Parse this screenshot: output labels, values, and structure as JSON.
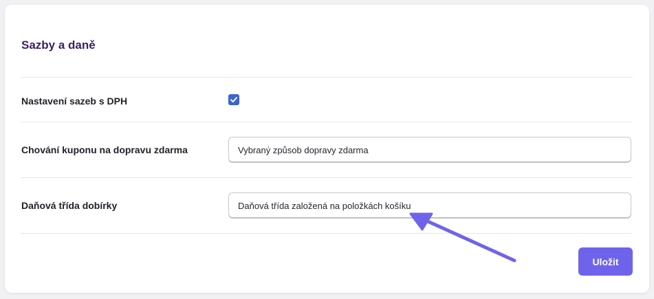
{
  "section": {
    "title": "Sazby a daně"
  },
  "settings": {
    "vat_rates": {
      "label": "Nastavení sazeb s DPH",
      "checked": true
    },
    "free_shipping_coupon": {
      "label": "Chování kuponu na dopravu zdarma",
      "value": "Vybraný způsob dopravy zdarma"
    },
    "cod_tax_class": {
      "label": "Daňová třída dobírky",
      "value": "Daňová třída založená na položkách košíku"
    }
  },
  "actions": {
    "save_label": "Uložit"
  },
  "colors": {
    "title": "#3b1f63",
    "accent": "#6f63ec",
    "checkbox": "#3a64d6",
    "annotation_arrow": "#6f63ec"
  },
  "icons": {
    "checkbox": "checkmark-icon",
    "annotation": "arrow-annotation-icon"
  }
}
